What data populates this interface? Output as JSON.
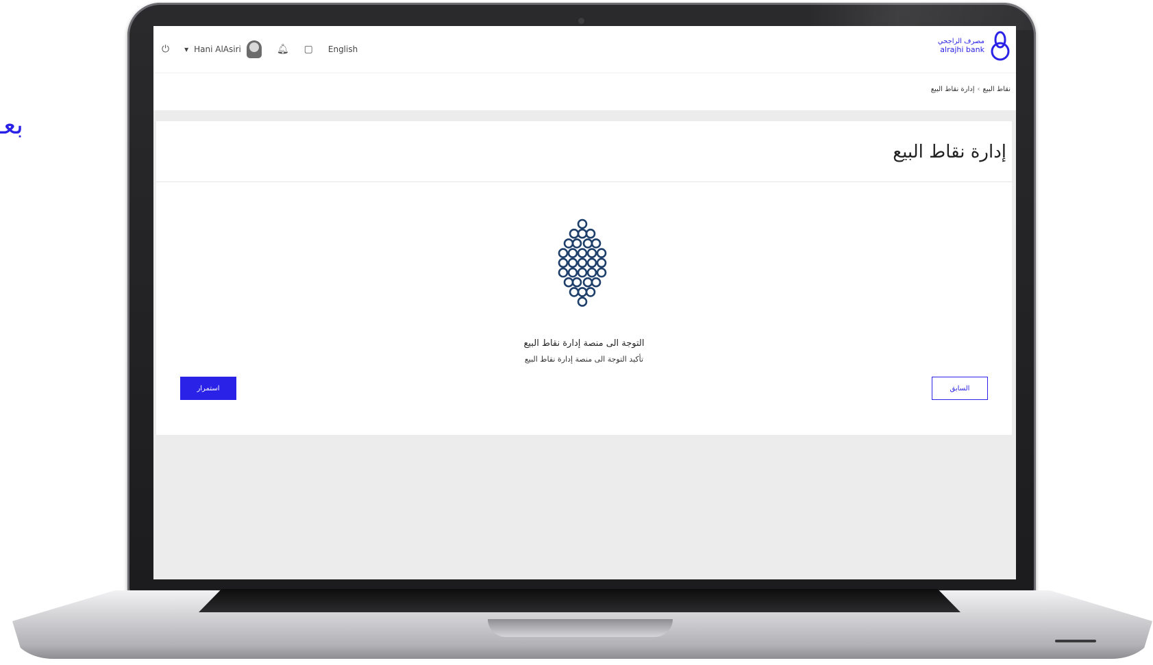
{
  "side_text": "بعـ",
  "header": {
    "language_link": "English",
    "user_name": "Hani AlAsiri",
    "icons": [
      "power-icon",
      "avatar-icon",
      "bell-icon",
      "calendar-icon"
    ],
    "logo_arabic": "مصرف الراجحي",
    "logo_english": "alrajhi bank"
  },
  "breadcrumb": {
    "parent": "نقاط البيع",
    "current": "إدارة نقاط البيع"
  },
  "page": {
    "title": "إدارة نقاط البيع",
    "message_title": "التوجة الى منصة إدارة نقاط البيع",
    "message_subtitle": "تأكيد التوجة الى منصة إدارة نقاط البيع"
  },
  "actions": {
    "continue_label": "استمرار",
    "back_label": "السابق"
  },
  "colors": {
    "accent": "#2a22e6",
    "icon_navy": "#1f3f6b"
  }
}
